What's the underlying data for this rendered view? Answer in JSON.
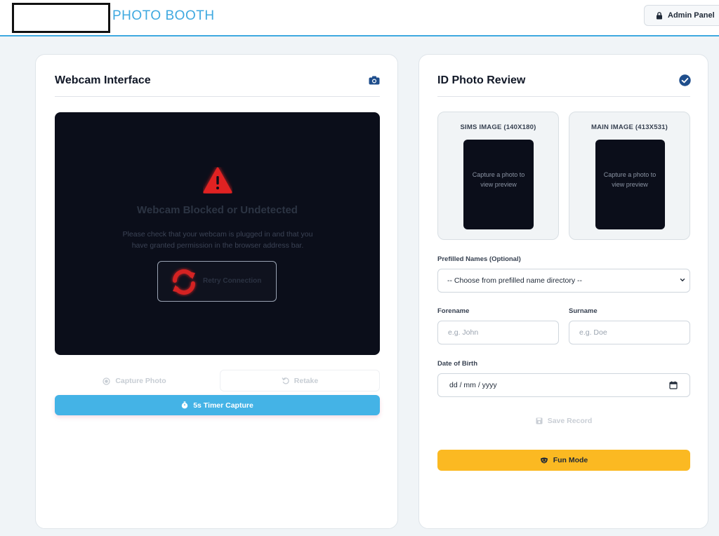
{
  "header": {
    "brand": "PHOTO BOOTH",
    "admin_label": "Admin Panel",
    "accent": "#3fa9e0"
  },
  "webcam": {
    "title": "Webcam Interface",
    "error_title": "Webcam Blocked or Undetected",
    "error_message": "Please check that your webcam is plugged in and that you have granted permission in the browser address bar.",
    "retry_label": "Retry Connection",
    "capture_label": "Capture Photo",
    "retake_label": "Retake",
    "timer_label": "5s Timer Capture"
  },
  "review": {
    "title": "ID Photo Review",
    "sims": {
      "heading": "SIMS IMAGE (140X180)",
      "placeholder": "Capture a photo to view preview"
    },
    "main": {
      "heading": "MAIN IMAGE (413X531)",
      "placeholder": "Capture a photo to view preview"
    },
    "prefilled_label": "Prefilled Names (Optional)",
    "prefilled_value": "-- Choose from prefilled name directory --",
    "forename_label": "Forename",
    "forename_placeholder": "e.g. John",
    "surname_label": "Surname",
    "surname_placeholder": "e.g. Doe",
    "dob_label": "Date of Birth",
    "dob_placeholder": "dd / mm / yyyy",
    "save_label": "Save Record",
    "fun_label": "Fun Mode"
  },
  "colors": {
    "timer_button": "#44b3e6",
    "fun_button": "#fbb922",
    "warning": "#e02424",
    "icon_blue": "#1f4e8c"
  },
  "icons": [
    "lock-icon",
    "camera-icon",
    "warning-icon",
    "refresh-icon",
    "circle-icon",
    "undo-icon",
    "stopwatch-icon",
    "check-circle-icon",
    "chevron-down-icon",
    "calendar-icon",
    "save-icon",
    "mask-icon"
  ]
}
